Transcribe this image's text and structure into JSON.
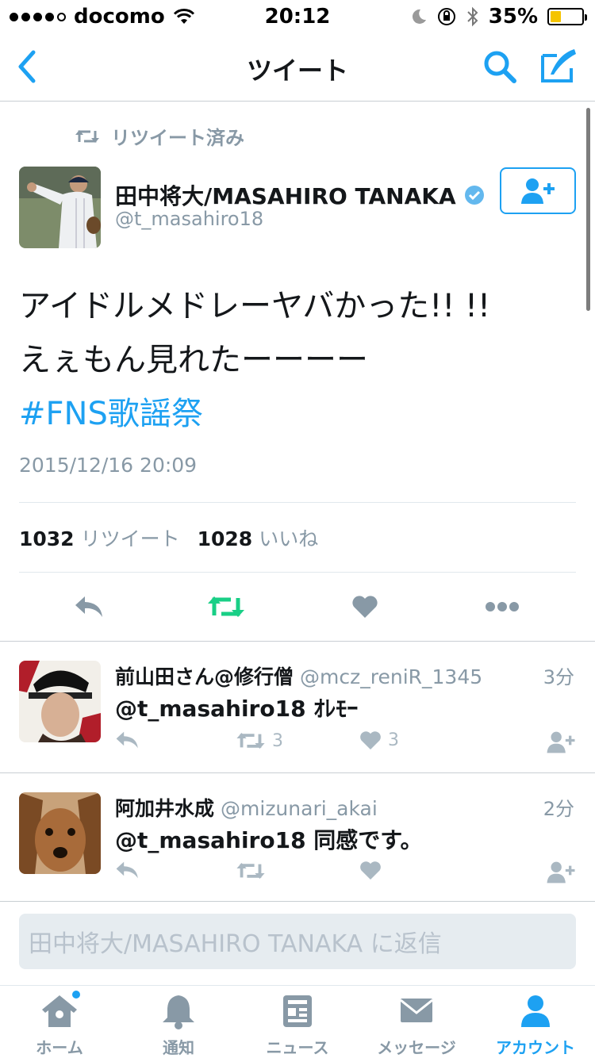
{
  "status_bar": {
    "carrier": "docomo",
    "time": "20:12",
    "battery": "35%",
    "battery_level": 0.35
  },
  "nav": {
    "title": "ツイート"
  },
  "tweet": {
    "retweet_note": "リツイート済み",
    "author_name": "田中将大/MASAHIRO TANAKA",
    "author_handle": "@t_masahiro18",
    "line1": "アイドルメドレーヤバかった!! !!",
    "line2": "えぇもん見れたーーーー",
    "hashtag": "#FNS歌謡祭",
    "date": "2015/12/16 20:09",
    "retweets": "1032",
    "retweets_label": "リツイート",
    "likes": "1028",
    "likes_label": "いいね"
  },
  "replies": [
    {
      "name": "前山田さん@修行僧",
      "handle": "@mcz_reniR_1345",
      "time": "3分",
      "text": "@t_masahiro18 ｵﾚﾓｰ",
      "retweets": "3",
      "likes": "3"
    },
    {
      "name": "阿加井水成",
      "handle": "@mizunari_akai",
      "time": "2分",
      "text": "@t_masahiro18 同感です。",
      "retweets": "",
      "likes": ""
    }
  ],
  "reply_box": {
    "placeholder": "田中将大/MASAHIRO TANAKA に返信"
  },
  "tabs": [
    {
      "label": "ホーム"
    },
    {
      "label": "通知"
    },
    {
      "label": "ニュース"
    },
    {
      "label": "メッセージ"
    },
    {
      "label": "アカウント"
    }
  ],
  "colors": {
    "accent": "#1da1f2",
    "retweet_green": "#19cf86",
    "muted": "#8899a6"
  }
}
